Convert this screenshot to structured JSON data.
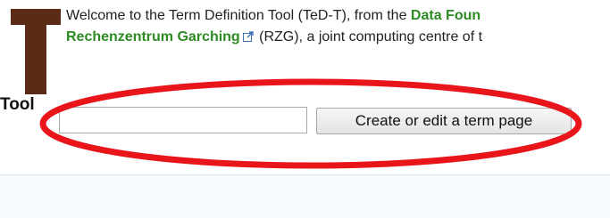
{
  "intro": {
    "line1_prefix": "Welcome to the Term Definition Tool (TeD-T), from the ",
    "line1_link": "Data Foun",
    "line2_link": "Rechenzentrum Garching",
    "line2_suffix": " (RZG), a joint computing centre of t"
  },
  "icons": {
    "logo": "letter-t-logo",
    "external_link": "external-link-icon"
  },
  "tool_label": "Tool",
  "term_form": {
    "input_value": "",
    "input_placeholder": "",
    "button_label": "Create or edit a term page"
  },
  "colors": {
    "logo_brown": "#5b2b16",
    "link_green": "#2e8b24",
    "annotation_red": "#e8151b",
    "panel_background": "#f7fbfd"
  }
}
